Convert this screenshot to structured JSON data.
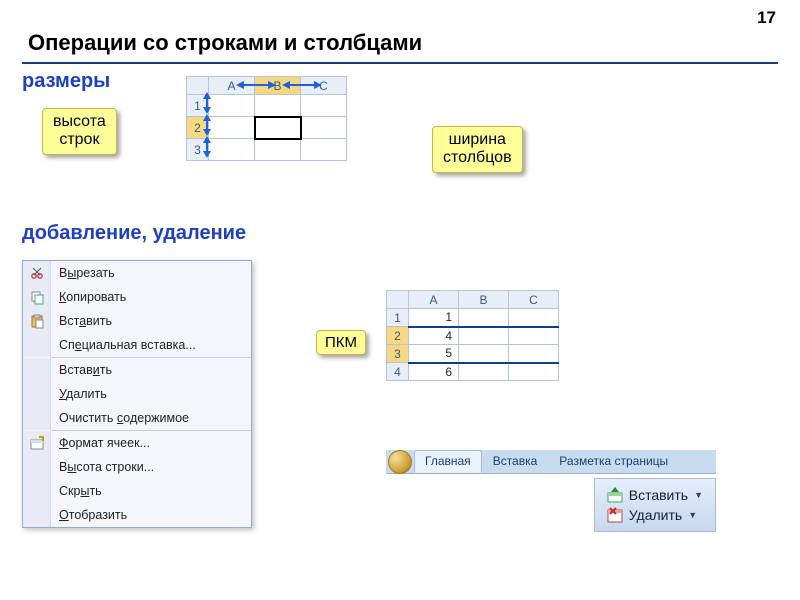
{
  "page_number": "17",
  "title": "Операции со строками и столбцами",
  "subheads": {
    "sizes": "размеры",
    "add_del": "добавление, удаление"
  },
  "callouts": {
    "row_height": "высота\nстрок",
    "col_width": "ширина\nстолбцов",
    "rmb": "ПКМ"
  },
  "grid1": {
    "cols": [
      "A",
      "B",
      "C"
    ],
    "rows": [
      "1",
      "2",
      "3"
    ]
  },
  "context_menu": {
    "items": [
      {
        "icon": "scissors",
        "label_pre": "В",
        "u": "ы",
        "label_post": "резать"
      },
      {
        "icon": "copy",
        "label_pre": "",
        "u": "К",
        "label_post": "опировать"
      },
      {
        "icon": "paste",
        "label_pre": "Вст",
        "u": "а",
        "label_post": "вить"
      },
      {
        "icon": "",
        "label_pre": "Сп",
        "u": "е",
        "label_post": "циальная вставка..."
      },
      {
        "sep": true
      },
      {
        "icon": "",
        "label_pre": "Встав",
        "u": "и",
        "label_post": "ть"
      },
      {
        "icon": "",
        "label_pre": "",
        "u": "У",
        "label_post": "далить"
      },
      {
        "icon": "",
        "label_pre": "Очистить ",
        "u": "с",
        "label_post": "одержимое"
      },
      {
        "sep": true
      },
      {
        "icon": "format",
        "label_pre": "",
        "u": "Ф",
        "label_post": "ормат ячеек..."
      },
      {
        "icon": "",
        "label_pre": "В",
        "u": "ы",
        "label_post": "сота строки..."
      },
      {
        "icon": "",
        "label_pre": "Скр",
        "u": "ы",
        "label_post": "ть"
      },
      {
        "icon": "",
        "label_pre": "",
        "u": "О",
        "label_post": "тобразить"
      }
    ]
  },
  "grid2": {
    "cols": [
      "A",
      "B",
      "C"
    ],
    "rows": [
      "1",
      "2",
      "3",
      "4"
    ],
    "data": {
      "A1": "1",
      "A2": "4",
      "A3": "5",
      "A4": "6"
    },
    "selected_rows": [
      "2",
      "3"
    ]
  },
  "ribbon": {
    "tabs": {
      "home": "Главная",
      "insert": "Вставка",
      "layout": "Разметка страницы"
    },
    "buttons": {
      "insert": "Вставить",
      "delete": "Удалить"
    }
  }
}
